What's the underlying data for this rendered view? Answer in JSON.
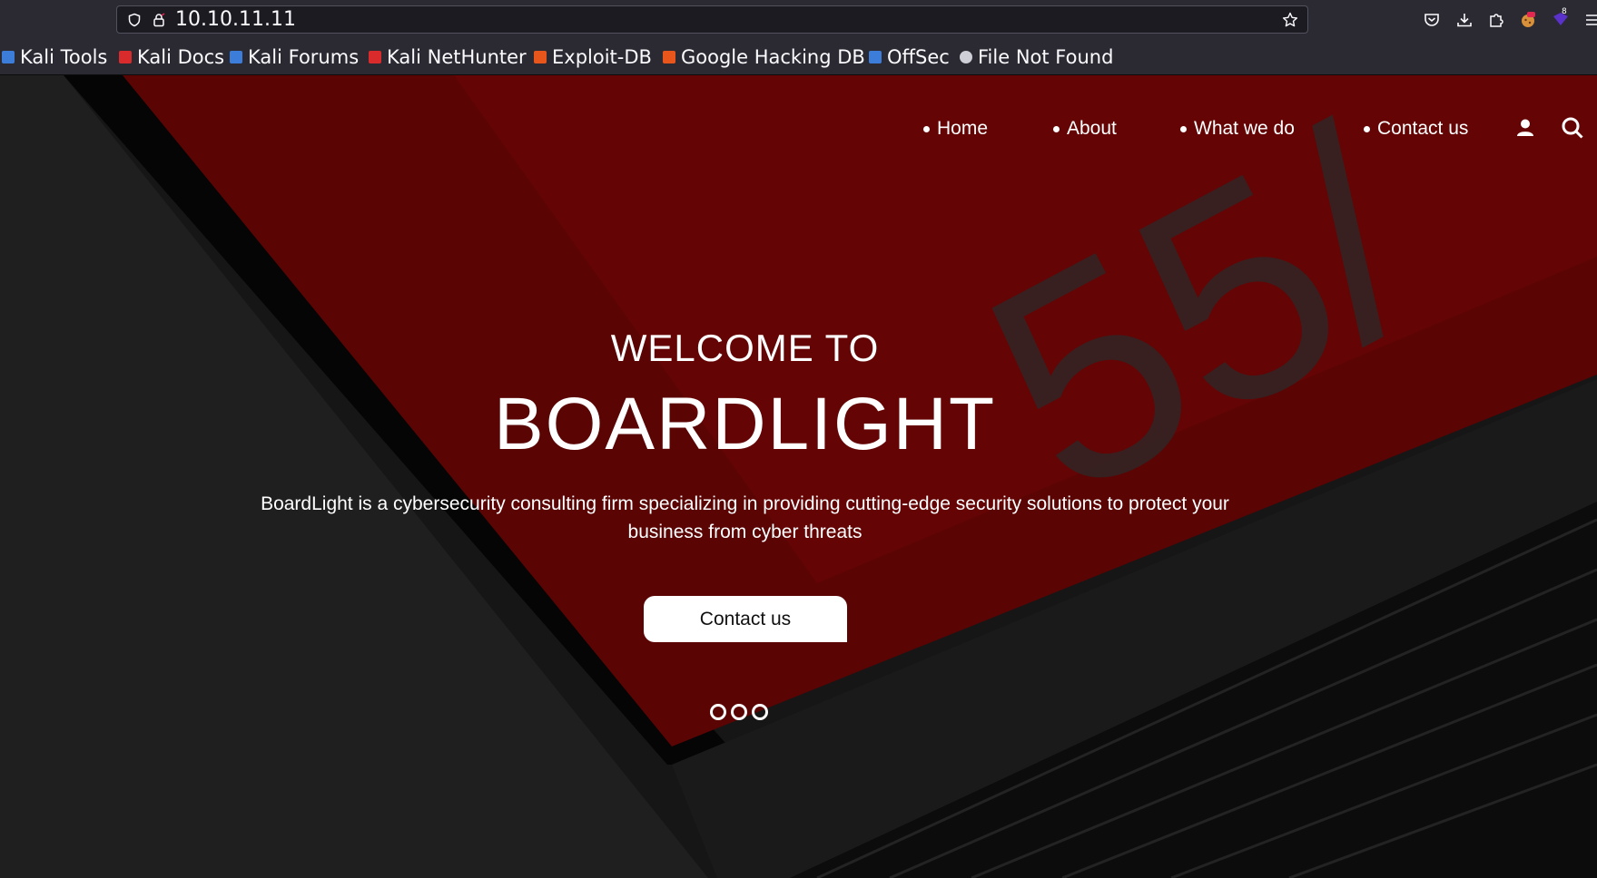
{
  "browser": {
    "url": "10.10.11.11",
    "bookmarks": [
      {
        "label": "Kali Tools",
        "color": "#3b7dd8"
      },
      {
        "label": "Kali Docs",
        "color": "#d92b2b"
      },
      {
        "label": "Kali Forums",
        "color": "#3b7dd8"
      },
      {
        "label": "Kali NetHunter",
        "color": "#d92b2b"
      },
      {
        "label": "Exploit-DB",
        "color": "#e8561c"
      },
      {
        "label": "Google Hacking DB",
        "color": "#e8561c"
      },
      {
        "label": "OffSec",
        "color": "#3b7dd8"
      },
      {
        "label": "File Not Found",
        "color": "#cfcfd8"
      }
    ],
    "extension_badge": "8"
  },
  "site": {
    "nav": [
      "Home",
      "About",
      "What we do",
      "Contact us"
    ],
    "icons": {
      "user": "user-icon",
      "search": "search-icon"
    },
    "hero": {
      "welcome": "WELCOME TO",
      "title": "BOARDLIGHT",
      "description": "BoardLight is a cybersecurity consulting firm specializing in providing cutting-edge security solutions to protect your business from cyber threats",
      "button": "Contact us",
      "slides": 3
    },
    "background_watermark": "55/",
    "colors": {
      "accent": "#7a0606",
      "page_bg": "#141414",
      "button_bg": "#ffffff"
    }
  }
}
